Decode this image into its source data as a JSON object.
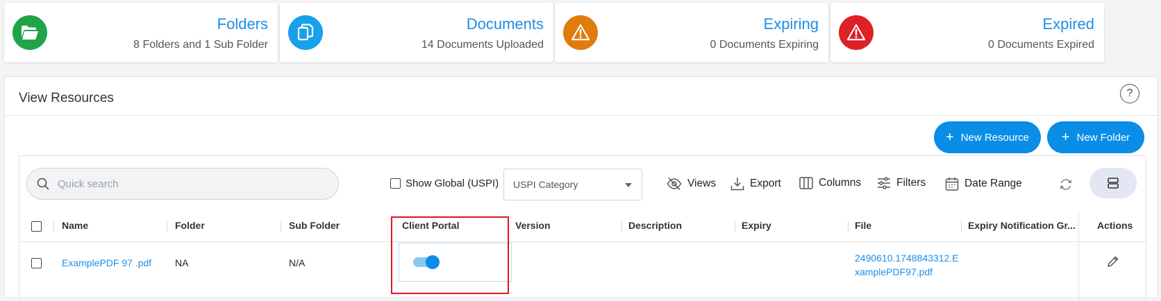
{
  "summary_cards": [
    {
      "title": "Folders",
      "subtitle": "8 Folders and 1 Sub Folder",
      "icon": "folder-icon",
      "color": "#21a34a"
    },
    {
      "title": "Documents",
      "subtitle": "14 Documents Uploaded",
      "icon": "documents-icon",
      "color": "#18a0e8"
    },
    {
      "title": "Expiring",
      "subtitle": "0 Documents Expiring",
      "icon": "warning-icon",
      "color": "#e07b0c"
    },
    {
      "title": "Expired",
      "subtitle": "0 Documents Expired",
      "icon": "warning-icon",
      "color": "#de2126"
    }
  ],
  "panel": {
    "title": "View Resources",
    "help_icon": "question-icon",
    "new_resource_label": "New Resource",
    "new_folder_label": "New Folder"
  },
  "toolbar": {
    "search_placeholder": "Quick search",
    "show_global_label": "Show Global (USPI)",
    "category_value": "USPI Category",
    "views_label": "Views",
    "export_label": "Export",
    "columns_label": "Columns",
    "filters_label": "Filters",
    "date_range_label": "Date Range"
  },
  "table": {
    "columns": [
      "Name",
      "Folder",
      "Sub Folder",
      "Client Portal",
      "Version",
      "Description",
      "Expiry",
      "File",
      "Expiry Notification Gr...",
      "Actions"
    ],
    "rows": [
      {
        "name": "ExamplePDF 97 .pdf",
        "folder": "NA",
        "sub_folder": "N/A",
        "client_portal": true,
        "version": "",
        "description": "",
        "expiry": "",
        "file_line1": "2490610.1748843312.E",
        "file_line2": "xamplePDF97.pdf",
        "expiry_notification": ""
      }
    ]
  },
  "colors": {
    "accent": "#0a8de6",
    "highlight": "#e0141e"
  }
}
